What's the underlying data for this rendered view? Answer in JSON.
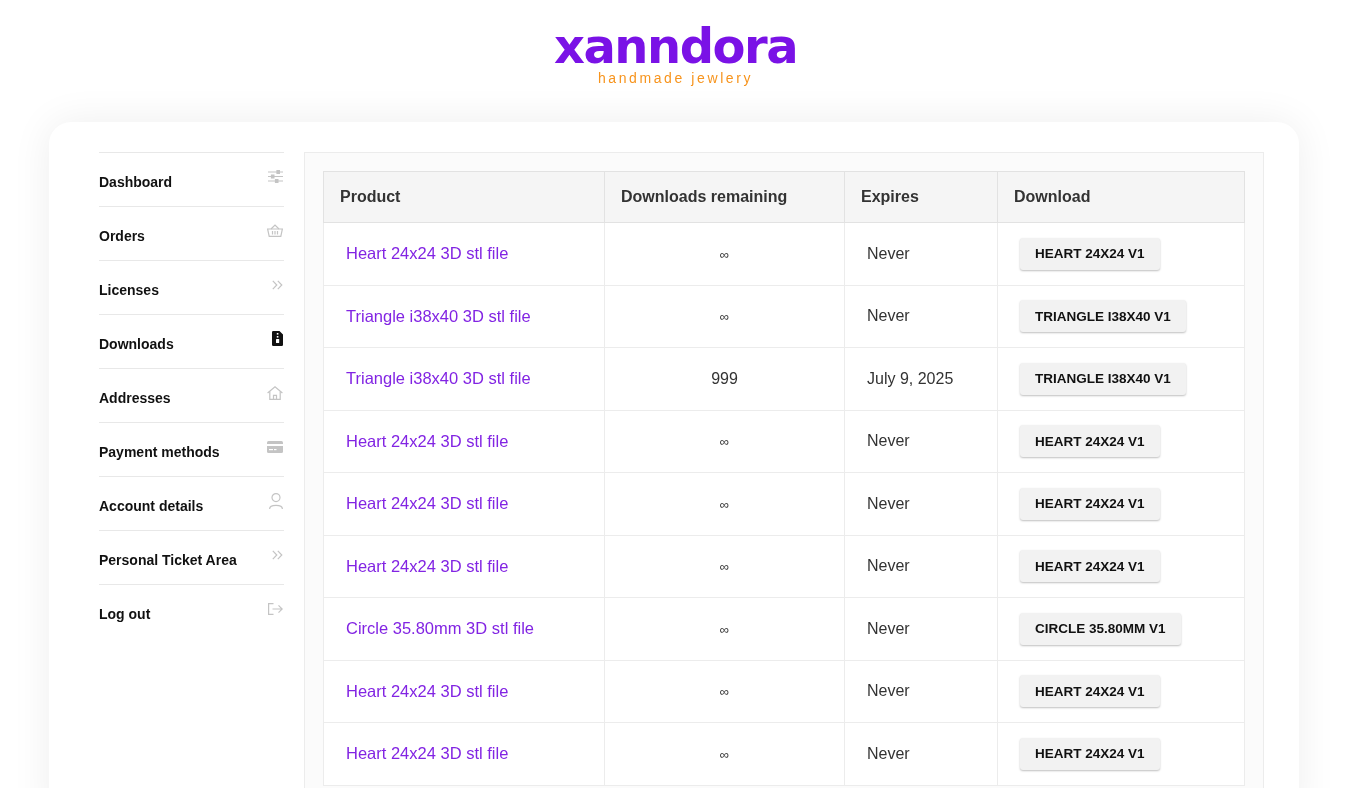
{
  "logo": {
    "name": "xanndora",
    "tagline": "handmade jewlery"
  },
  "nav": [
    {
      "label": "Dashboard",
      "selected": false
    },
    {
      "label": "Orders",
      "selected": false
    },
    {
      "label": "Licenses",
      "selected": false
    },
    {
      "label": "Downloads",
      "selected": true
    },
    {
      "label": "Addresses",
      "selected": false
    },
    {
      "label": "Payment methods",
      "selected": false
    },
    {
      "label": "Account details",
      "selected": false
    },
    {
      "label": "Personal Ticket Area",
      "selected": false
    },
    {
      "label": "Log out",
      "selected": false
    }
  ],
  "table": {
    "columns": [
      "Product",
      "Downloads remaining",
      "Expires",
      "Download"
    ],
    "rows": [
      {
        "product": "Heart 24x24 3D stl file",
        "downloads_remaining": "∞",
        "expires": "Never",
        "download": "HEART 24X24 V1"
      },
      {
        "product": "Triangle i38x40 3D stl file",
        "downloads_remaining": "∞",
        "expires": "Never",
        "download": "TRIANGLE I38X40 V1"
      },
      {
        "product": "Triangle i38x40 3D stl file",
        "downloads_remaining": "999",
        "expires": "July 9, 2025",
        "download": "TRIANGLE I38X40 V1"
      },
      {
        "product": "Heart 24x24 3D stl file",
        "downloads_remaining": "∞",
        "expires": "Never",
        "download": "HEART 24X24 V1"
      },
      {
        "product": "Heart 24x24 3D stl file",
        "downloads_remaining": "∞",
        "expires": "Never",
        "download": "HEART 24X24 V1"
      },
      {
        "product": "Heart 24x24 3D stl file",
        "downloads_remaining": "∞",
        "expires": "Never",
        "download": "HEART 24X24 V1"
      },
      {
        "product": "Circle 35.80mm 3D stl file",
        "downloads_remaining": "∞",
        "expires": "Never",
        "download": "CIRCLE 35.80MM V1"
      },
      {
        "product": "Heart 24x24 3D stl file",
        "downloads_remaining": "∞",
        "expires": "Never",
        "download": "HEART 24X24 V1"
      },
      {
        "product": "Heart 24x24 3D stl file",
        "downloads_remaining": "∞",
        "expires": "Never",
        "download": "HEART 24X24 V1"
      }
    ]
  }
}
